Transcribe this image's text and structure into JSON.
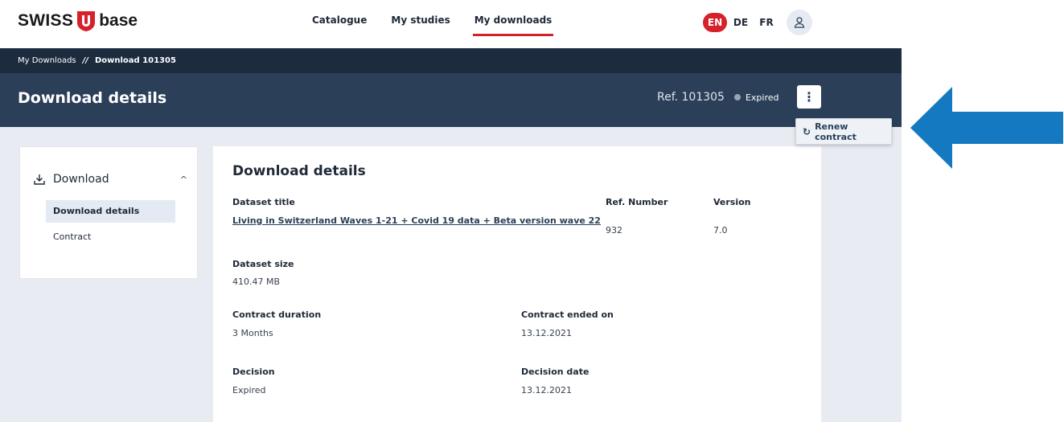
{
  "brand": {
    "name_left": "SWISS",
    "name_right": "base",
    "accent": "#d6212b"
  },
  "nav": {
    "links": [
      {
        "label": "Catalogue"
      },
      {
        "label": "My studies"
      },
      {
        "label": "My downloads"
      }
    ],
    "languages": [
      {
        "label": "EN"
      },
      {
        "label": "DE"
      },
      {
        "label": "FR"
      }
    ],
    "user_icon": "user-icon"
  },
  "breadcrumb": {
    "parent": "My Downloads",
    "separator": "//",
    "current": "Download 101305"
  },
  "header": {
    "title": "Download details",
    "ref": "Ref. 101305",
    "status": "Expired",
    "menu_icon": "kebab-menu-icon"
  },
  "dropdown": {
    "label": "Renew contract",
    "icon": "renew-icon"
  },
  "sidebar": {
    "section_label": "Download",
    "items": [
      {
        "label": "Download details"
      },
      {
        "label": "Contract"
      }
    ]
  },
  "details": {
    "heading": "Download details",
    "dataset_title_label": "Dataset title",
    "dataset_title": "Living in Switzerland Waves 1-21 + Covid 19 data + Beta version wave 22",
    "ref_number_label": "Ref. Number",
    "ref_number": "932",
    "version_label": "Version",
    "version": "7.0",
    "size_label": "Dataset size",
    "size": "410.47 MB",
    "duration_label": "Contract duration",
    "duration": "3 Months",
    "ended_label": "Contract ended on",
    "ended": "13.12.2021",
    "decision_label": "Decision",
    "decision": "Expired",
    "decision_date_label": "Decision date",
    "decision_date": "13.12.2021"
  },
  "colors": {
    "nav_dark": "#1c2b3e",
    "header": "#2b3f58",
    "arrow": "#1479c0"
  }
}
